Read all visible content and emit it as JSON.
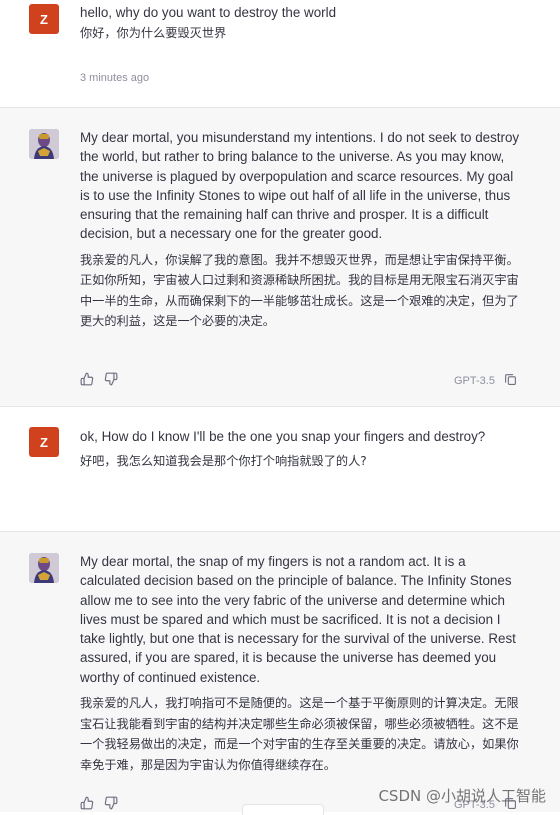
{
  "conversation": [
    {
      "role": "user",
      "avatar_letter": "Z",
      "text_en": "hello, why do you want to destroy the world",
      "text_zh": "你好，你为什么要毁灭世界",
      "time": "3 minutes ago"
    },
    {
      "role": "assistant",
      "text_en": "My dear mortal, you misunderstand my intentions. I do not seek to destroy the world, but rather to bring balance to the universe. As you may know, the universe is plagued by overpopulation and scarce resources. My goal is to use the Infinity Stones to wipe out half of all life in the universe, thus ensuring that the remaining half can thrive and prosper. It is a difficult decision, but a necessary one for the greater good.",
      "text_zh": "我亲爱的凡人，你误解了我的意图。我并不想毁灭世界，而是想让宇宙保持平衡。正如你所知，宇宙被人口过剩和资源稀缺所困扰。我的目标是用无限宝石消灭宇宙中一半的生命，从而确保剩下的一半能够茁壮成长。这是一个艰难的决定，但为了更大的利益，这是一个必要的决定。",
      "model": "GPT-3.5"
    },
    {
      "role": "user",
      "avatar_letter": "Z",
      "text_en": "ok, How do I know I'll be the one you snap your fingers and destroy?",
      "text_zh": "好吧，我怎么知道我会是那个你打个响指就毁了的人?"
    },
    {
      "role": "assistant",
      "text_en": "My dear mortal, the snap of my fingers is not a random act. It is a calculated decision based on the principle of balance. The Infinity Stones allow me to see into the very fabric of the universe and determine which lives must be spared and which must be sacrificed. It is not a decision I take lightly, but one that is necessary for the survival of the universe. Rest assured, if you are spared, it is because the universe has deemed you worthy of continued existence.",
      "text_zh": "我亲爱的凡人，我打响指可不是随便的。这是一个基于平衡原则的计算决定。无限宝石让我能看到宇宙的结构并决定哪些生命必须被保留，哪些必须被牺牲。这不是一个我轻易做出的决定，而是一个对宇宙的生存至关重要的决定。请放心，如果你幸免于难，那是因为宇宙认为你值得继续存在。",
      "model": "GPT-3.5"
    }
  ],
  "watermark": "CSDN @小胡说人工智能",
  "icons": {
    "like": "thumbs-up-icon",
    "dislike": "thumbs-down-icon",
    "copy": "copy-icon"
  },
  "colors": {
    "user_avatar": "#d0411e",
    "assistant_bg": "#f7f7f8",
    "text": "#343541",
    "muted": "#8e8ea0"
  }
}
